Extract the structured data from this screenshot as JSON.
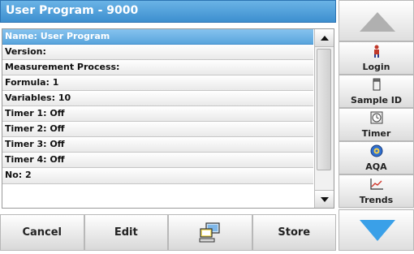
{
  "header": {
    "title": "User Program - 9000"
  },
  "list": {
    "rows": [
      "Name: User Program",
      "Version:",
      "Measurement Process:",
      "Formula: 1",
      "Variables: 10",
      "Timer 1: Off",
      "Timer 2: Off",
      "Timer 3: Off",
      "Timer 4: Off",
      "No: 2"
    ],
    "selected_index": 0
  },
  "bottom_bar": {
    "cancel_label": "Cancel",
    "edit_label": "Edit",
    "computer_icon": "computer-icon",
    "store_label": "Store"
  },
  "sidebar": {
    "buttons": [
      {
        "label": "Login",
        "icon": "login-person-icon"
      },
      {
        "label": "Sample ID",
        "icon": "sample-container-icon"
      },
      {
        "label": "Timer",
        "icon": "timer-clock-icon"
      },
      {
        "label": "AQA",
        "icon": "aqa-globe-icon"
      },
      {
        "label": "Trends",
        "icon": "trends-chart-icon"
      }
    ]
  },
  "colors": {
    "title_blue": "#3d8fcf",
    "selection_blue": "#5aa5dd",
    "nav_arrow_gray": "#b0b0b0",
    "nav_arrow_blue": "#3aa0e8"
  }
}
